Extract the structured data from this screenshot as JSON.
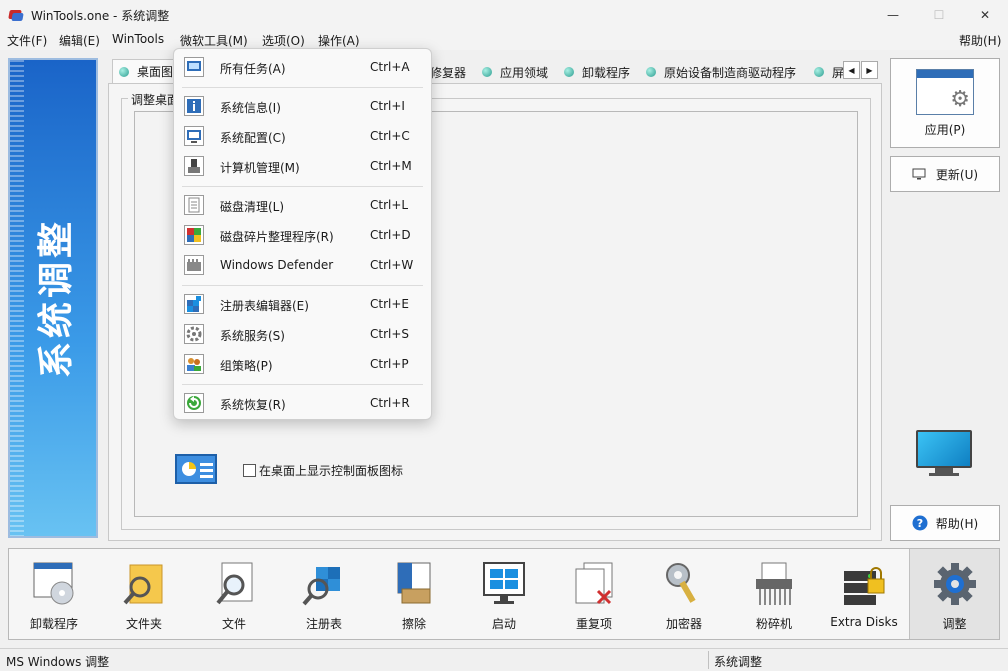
{
  "window": {
    "title": "WinTools.one - 系统调整",
    "minimize": "—",
    "maximize": "☐",
    "close": "✕"
  },
  "menubar": {
    "file": "文件(F)",
    "edit": "编辑(E)",
    "wintools": "WinTools",
    "ms_tools": "微软工具(M)",
    "options": "选项(O)",
    "actions": "操作(A)",
    "help": "帮助(H)"
  },
  "banner": {
    "text": "系统调整"
  },
  "tabs": {
    "first": "桌面图",
    "repairer": "修复器",
    "app_domain": "应用领域",
    "uninstall": "卸载程序",
    "oem_drivers": "原始设备制造商驱动程序",
    "last": "屏",
    "arrow_left": "◀",
    "arrow_right": "▶"
  },
  "panel": {
    "group_title": "调整桌面",
    "checkbox_label": "在桌面上显示控制面板图标",
    "checkbox_checked": false
  },
  "right_buttons": {
    "apply": "应用(P)",
    "update": "更新(U)",
    "help": "帮助(H)"
  },
  "toolbar": {
    "uninstall": "卸载程序",
    "folder": "文件夹",
    "file": "文件",
    "registry": "注册表",
    "eraser": "擦除",
    "startup": "启动",
    "duplicates": "重复项",
    "encryptor": "加密器",
    "shredder": "粉碎机",
    "extra_disks": "Extra Disks",
    "tweak": "调整"
  },
  "status": {
    "left": "MS Windows 调整",
    "right": "系统调整"
  },
  "dropdown": {
    "items": [
      {
        "label": "所有任务(A)",
        "shortcut": "Ctrl+A"
      },
      {
        "label": "系统信息(I)",
        "shortcut": "Ctrl+I"
      },
      {
        "label": "系统配置(C)",
        "shortcut": "Ctrl+C"
      },
      {
        "label": "计算机管理(M)",
        "shortcut": "Ctrl+M"
      },
      {
        "label": "磁盘清理(L)",
        "shortcut": "Ctrl+L"
      },
      {
        "label": "磁盘碎片整理程序(R)",
        "shortcut": "Ctrl+D"
      },
      {
        "label": "Windows Defender",
        "shortcut": "Ctrl+W"
      },
      {
        "label": "注册表编辑器(E)",
        "shortcut": "Ctrl+E"
      },
      {
        "label": "系统服务(S)",
        "shortcut": "Ctrl+S"
      },
      {
        "label": "组策略(P)",
        "shortcut": "Ctrl+P"
      },
      {
        "label": "系统恢复(R)",
        "shortcut": "Ctrl+R"
      }
    ]
  }
}
